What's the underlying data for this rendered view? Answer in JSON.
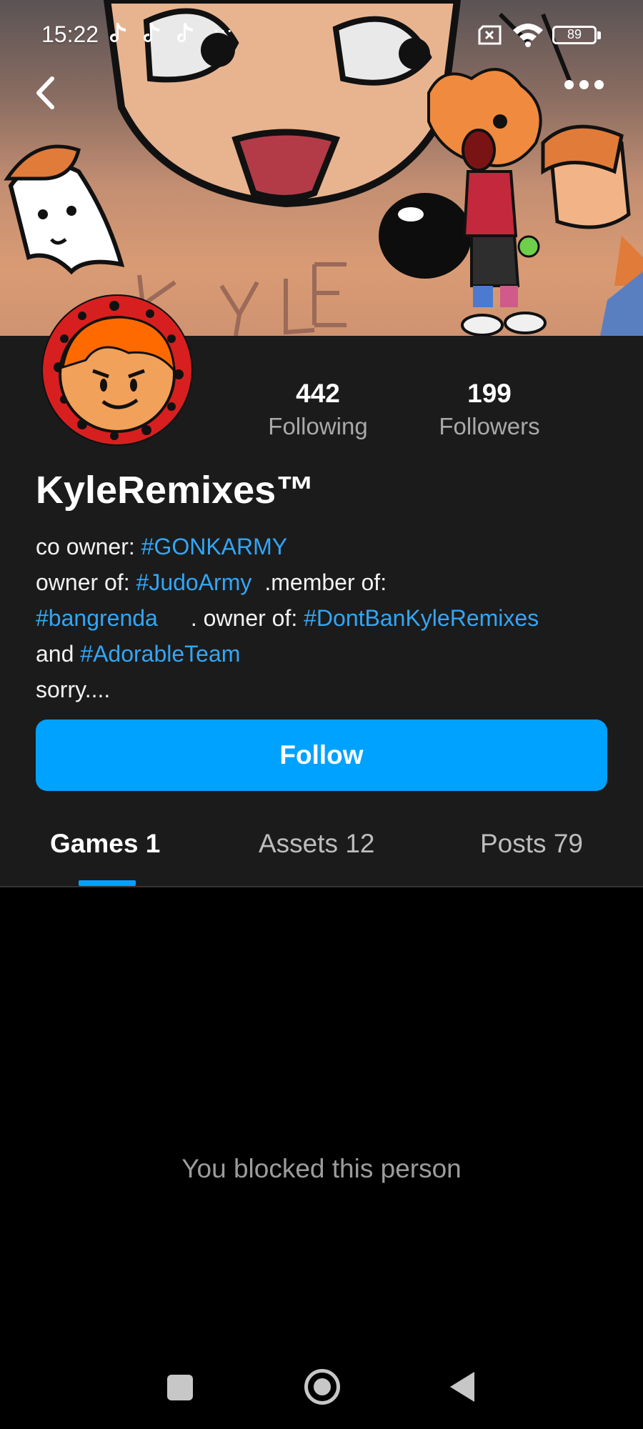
{
  "status_bar": {
    "time": "15:22",
    "notification_icons": [
      "tiktok-icon",
      "tiktok-icon",
      "tiktok-icon"
    ],
    "more_indicator": "···",
    "battery": "89"
  },
  "header": {
    "back_icon": "chevron-left-icon",
    "more_icon": "more-horizontal-icon"
  },
  "profile": {
    "username": "KyleRemixes™",
    "stats": {
      "following_count": "442",
      "following_label": "Following",
      "followers_count": "199",
      "followers_label": "Followers"
    },
    "bio": {
      "line1_prefix": "co owner: ",
      "line1_tag": "#GONKARMY",
      "line2_prefix": "owner of: ",
      "line2_tag": "#JudoArmy",
      "line2_suffix": ".member of:",
      "line3_tag": "#bangrenda",
      "line3_mid": ".  owner of: ",
      "line3_tag2": "#DontBanKyleRemixes",
      "line4_prefix": "and ",
      "line4_tag": "#AdorableTeam",
      "line5": "sorry...."
    },
    "follow_label": "Follow"
  },
  "tabs": [
    {
      "label": "Games 1",
      "active": true
    },
    {
      "label": "Assets 12",
      "active": false
    },
    {
      "label": "Posts 79",
      "active": false
    }
  ],
  "content": {
    "blocked_message": "You blocked this person"
  },
  "colors": {
    "accent": "#00a2ff",
    "hashtag": "#32a6f7",
    "panel": "#1b1b1b",
    "background": "#000000"
  }
}
